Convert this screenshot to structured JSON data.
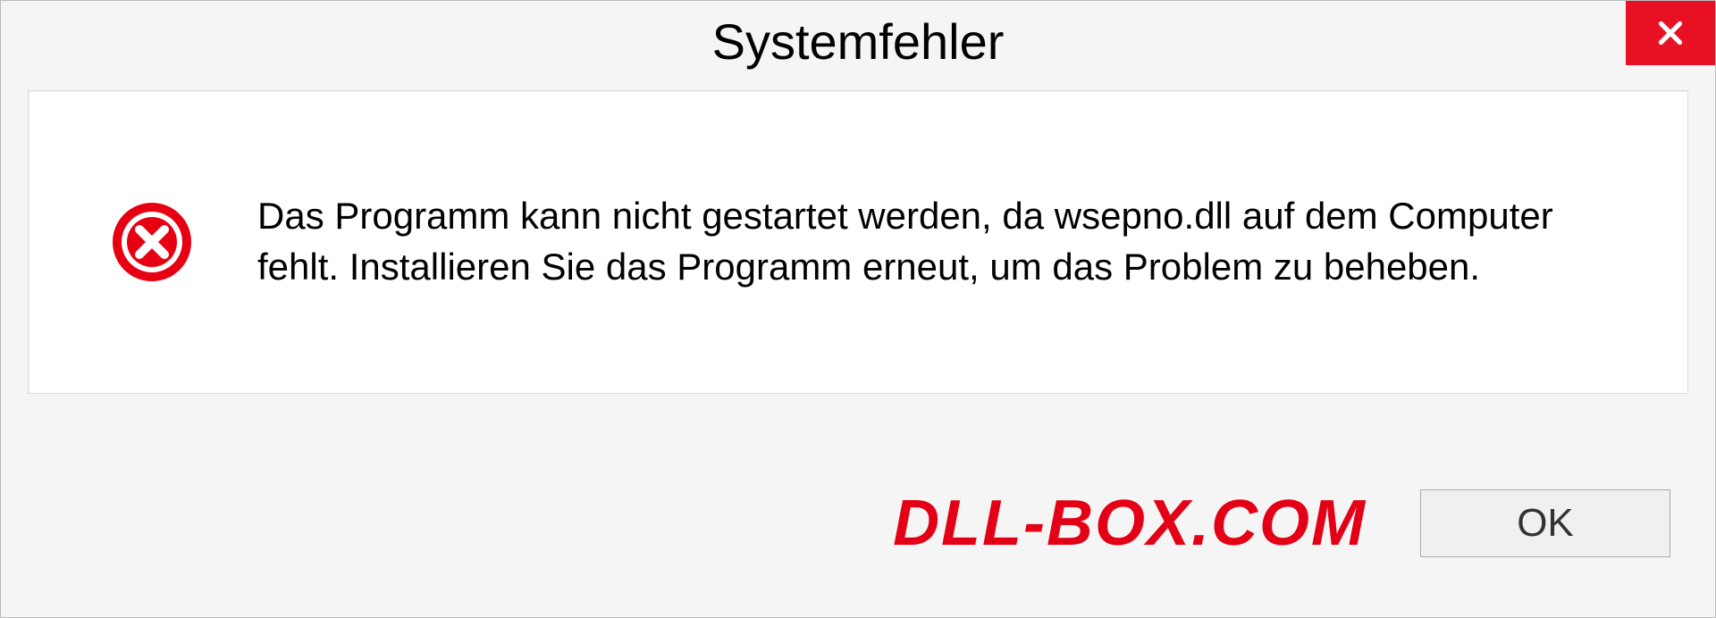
{
  "dialog": {
    "title": "Systemfehler",
    "message": "Das Programm kann nicht gestartet werden, da wsepno.dll auf dem Computer fehlt. Installieren Sie das Programm erneut, um das Problem zu beheben.",
    "ok_label": "OK"
  },
  "watermark": {
    "text": "DLL-BOX.COM"
  },
  "colors": {
    "close_bg": "#e81123",
    "error_icon": "#e60012",
    "watermark": "#e30016"
  }
}
